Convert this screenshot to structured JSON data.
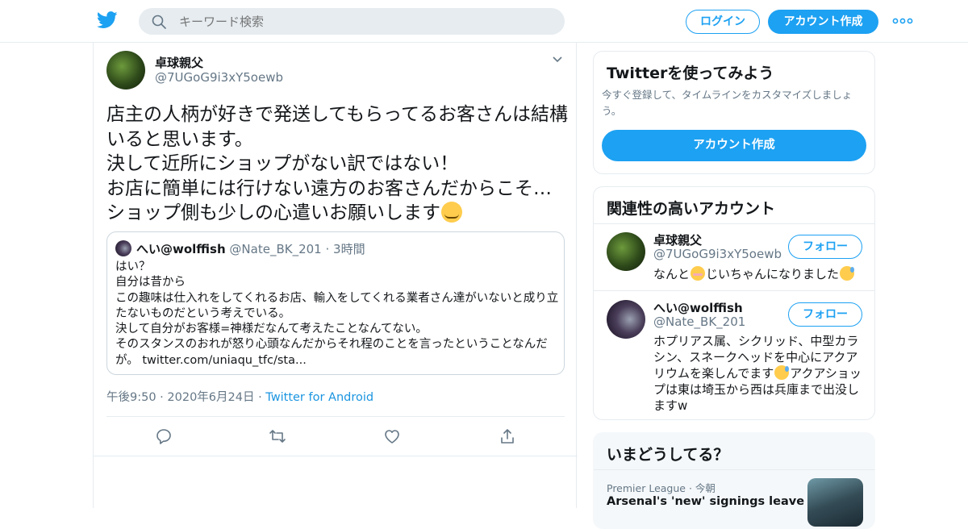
{
  "header": {
    "search_placeholder": "キーワード検索",
    "login_label": "ログイン",
    "signup_label": "アカウント作成"
  },
  "tweet": {
    "author_name": "卓球親父",
    "author_handle": "@7UGoG9i3xY5oewb",
    "text": "店主の人柄が好きで発送してもらってるお客さんは結構いると思います。\n決して近所にショップがない訳ではない！\nお店に簡単には行けない遠方のお客さんだからこそ…\nショップ側も少しの心遣いお願いします",
    "text_emoji": "smiling-face-with-smiling-eyes",
    "quote": {
      "author_name": "へい@wolffish",
      "author_handle": "@Nate_BK_201",
      "time": "3時間",
      "text": "はい？\n自分は昔から\nこの趣味は仕入れをしてくれるお店、輸入をしてくれる業者さん達がいないと成り立たないものだという考えでいる。\n決して自分がお客様=神様だなんて考えたことなんてない。\nそのスタンスのおれが怒り心頭なんだからそれ程のことを言ったということなんだが。 twitter.com/uniaqu_tfc/sta..."
    },
    "time": "午後9:50",
    "date": "2020年6月24日",
    "via": "Twitter for Android"
  },
  "sidebar": {
    "try_card": {
      "title": "Twitterを使ってみよう",
      "subtitle": "今すぐ登録して、タイムラインをカスタマイズしましょう。",
      "button_label": "アカウント作成"
    },
    "related": {
      "title": "関連性の高いアカウント",
      "follow_label": "フォロー",
      "accounts": [
        {
          "name": "卓球親父",
          "handle": "@7UGoG9i3xY5oewb",
          "bio_a": "なんと",
          "bio_b": "じいちゃんになりました"
        },
        {
          "name": "へい@wolffish",
          "handle": "@Nate_BK_201",
          "bio_a": "ホプリアス属、シクリッド、中型カラシン、スネークヘッドを中心にアクアリウムを楽しんでます",
          "bio_b": "アクアショップは東は埼玉から西は兵庫まで出没しますw"
        }
      ]
    },
    "trends": {
      "title": "いまどうしてる？",
      "items": [
        {
          "meta": "Premier League · 今朝",
          "title": "Arsenal's 'new' signings leave"
        }
      ]
    }
  },
  "colors": {
    "accent": "#1da1f2",
    "border": "#e6ecf0",
    "secondary_text": "#657786"
  }
}
